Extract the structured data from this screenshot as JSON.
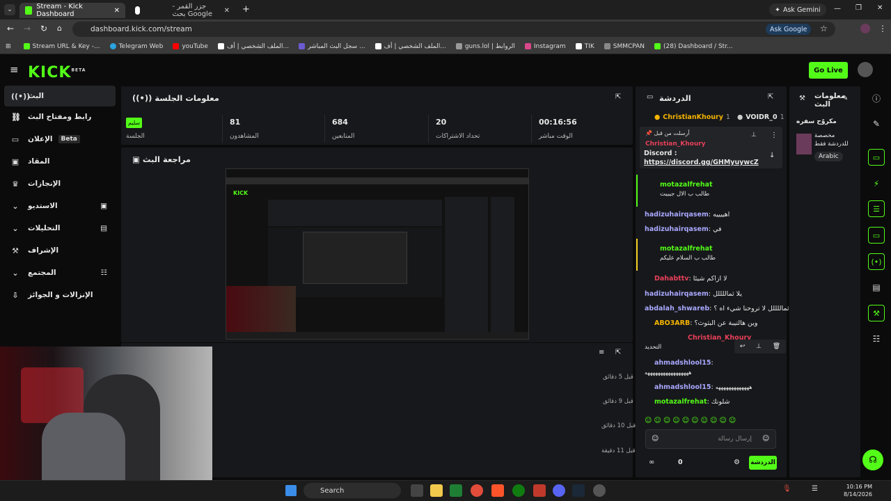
{
  "browser": {
    "tabs": [
      {
        "title": "Stream - Kick Dashboard"
      },
      {
        "title": "جزر القمر - بحث Google"
      }
    ],
    "ask_gemini": "Ask Gemini",
    "url": "dashboard.kick.com/stream",
    "ask_google": "Ask Google",
    "bookmarks": [
      "Stream URL & Key -...",
      "Telegram Web",
      "youTube",
      "الملف الشخصي | أف...",
      "سجل البث المباشر ...",
      "الملف الشخصي | أف...",
      "guns.lol | الروابط",
      "Instagram",
      "TIK",
      "SMMCPAN",
      "(28) Dashboard / Str..."
    ]
  },
  "app": {
    "logo": "KICK",
    "logo_beta": "BETA",
    "go_live": "Go Live"
  },
  "sidebar": {
    "items": [
      {
        "label": "البث"
      },
      {
        "label": "رابط ومفتاح البث"
      },
      {
        "label": "الإعلان",
        "badge": "Beta"
      },
      {
        "label": "المقاد"
      },
      {
        "label": "الإنجازات"
      },
      {
        "label": "الاستديو"
      },
      {
        "label": "التحليلات"
      },
      {
        "label": "الإشراف"
      },
      {
        "label": "المجتمع"
      },
      {
        "label": "الإنزالات و الجوائز"
      }
    ]
  },
  "session": {
    "title": "معلومات الجلسة",
    "stats": [
      {
        "value": "00:16:56",
        "label": "الوقت مباشر"
      },
      {
        "value": "20",
        "label": "تحداد الاشتراكات"
      },
      {
        "value": "684",
        "label": "المتابعين"
      },
      {
        "value": "81",
        "label": "المشاهدون"
      }
    ],
    "session_label": "الجلسة",
    "session_badge": "سليم"
  },
  "preview": {
    "title": "مراجعة البث"
  },
  "activity": {
    "times": [
      "قبل 5 دقائق",
      "قبل 9 دقائق",
      "قبل 10 دقائق",
      "قبل 11 دقيقة"
    ]
  },
  "chat": {
    "title": "الدردشة",
    "top_users": [
      {
        "name": "ChristianKhoury",
        "rank": "1"
      },
      {
        "name": "VOIDR_0",
        "rank": "1"
      }
    ],
    "pinned": {
      "header": "أرسلت من قبل",
      "user": "Christian_Khoury",
      "text": "Discord :",
      "link": "https://discord.gg/GHMyuywcZ"
    },
    "messages": [
      {
        "user": "motazalfrehat",
        "text": "طالب ب الال جيبيت"
      },
      {
        "user": "hadizuhairqasem",
        "text": "اهييييه"
      },
      {
        "user": "hadizuhairqasem",
        "text": "في"
      },
      {
        "user": "motazalfrehat",
        "text": "طالب ب السلام عليكم"
      },
      {
        "user": "Dahabttv",
        "text": "لا ازاكم شيئا"
      },
      {
        "user": "hadizuhairqasem",
        "text": "يلا ثماللللل"
      },
      {
        "user": "abdalah_shwareb",
        "text": "ثماللللل لا تروحنا شيء اه ؟"
      },
      {
        "user": "ABO3ARB",
        "text": "وين هالتيبة عن البثوث؟"
      },
      {
        "user": "Christian_Khoury",
        "text": "التحديد"
      },
      {
        "user": "ahmadshlool15",
        "text": "هههههههههههههههههه"
      },
      {
        "user": "ahmadshlool15",
        "text": "هههههههههههههه"
      },
      {
        "user": "motazalfrehat",
        "text": "شلونك"
      }
    ],
    "input_placeholder": "إرسال رسالة",
    "send": "الدردشة",
    "count": "0"
  },
  "streaminfo": {
    "title": "معلومات البث",
    "stream_title": "مكروّح سفره",
    "category": "مخصصة للدردشة فقط",
    "language": "Arabic"
  },
  "taskbar": {
    "search": "Search",
    "time": "10:16 PM",
    "date": "8/14/2026"
  },
  "colors": {
    "accent": "#53fc18",
    "bg": "#0b0b0c",
    "panel": "#17181b"
  }
}
